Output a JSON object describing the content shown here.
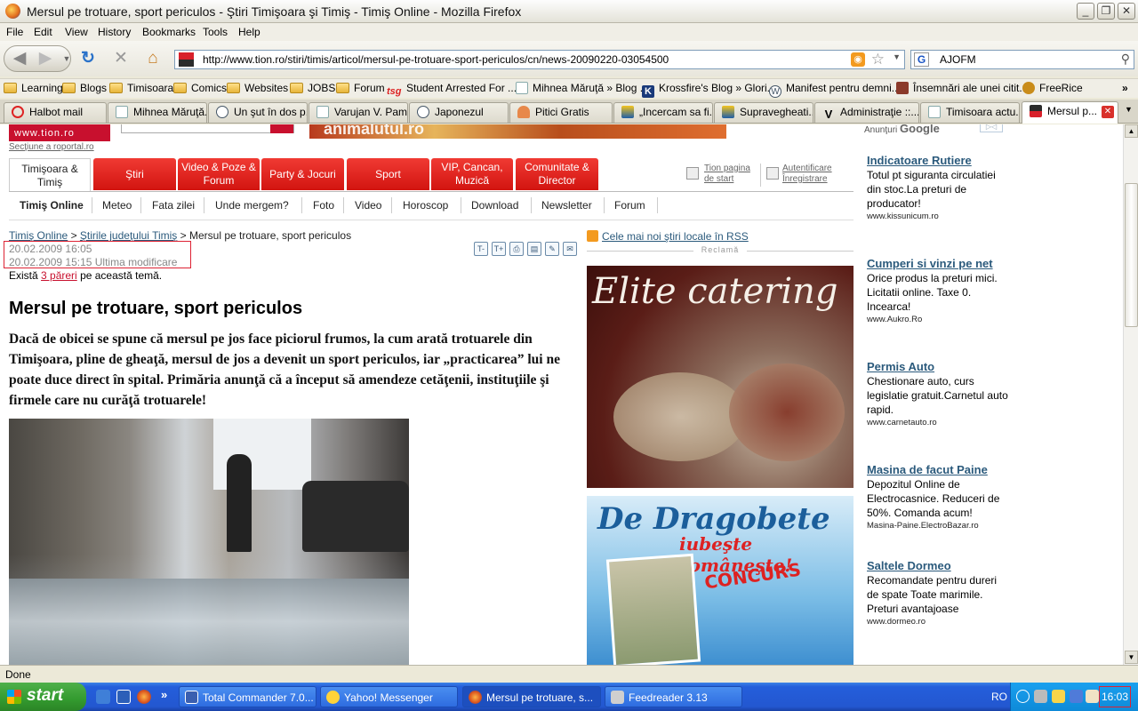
{
  "window": {
    "title": "Mersul pe trotuare, sport periculos - Ştiri Timişoara şi Timiş - Timiş Online - Mozilla Firefox"
  },
  "menu": [
    "File",
    "Edit",
    "View",
    "History",
    "Bookmarks",
    "Tools",
    "Help"
  ],
  "nav": {
    "url": "http://www.tion.ro/stiri/timis/articol/mersul-pe-trotuare-sport-periculos/cn/news-20090220-03054500",
    "search_value": "AJOFM"
  },
  "bookmarks": [
    {
      "label": "Learning",
      "icon": "folder-icon"
    },
    {
      "label": "Blogs",
      "icon": "folder-icon"
    },
    {
      "label": "Timisoara",
      "icon": "folder-icon"
    },
    {
      "label": "Comics",
      "icon": "folder-icon"
    },
    {
      "label": "Websites",
      "icon": "folder-icon"
    },
    {
      "label": "JOBS",
      "icon": "folder-icon"
    },
    {
      "label": "Forum",
      "icon": "folder-icon"
    },
    {
      "label": "Student Arrested For ...",
      "icon": "tsg-icon"
    },
    {
      "label": "Mihnea Măruţă » Blog ...",
      "icon": "page-icon"
    },
    {
      "label": "Krossfire's Blog » Glori...",
      "icon": "k-icon"
    },
    {
      "label": "Manifest pentru demni...",
      "icon": "wordpress-icon"
    },
    {
      "label": "Însemnări ale unei citit...",
      "icon": "avatar-icon"
    },
    {
      "label": "FreeRice",
      "icon": "freerice-icon"
    }
  ],
  "tabs": [
    {
      "label": "Halbot mail",
      "icon": "no-entry-icon"
    },
    {
      "label": "Mihnea Măruţă...",
      "icon": "page-icon"
    },
    {
      "label": "Un şut în dos p...",
      "icon": "wordpress-icon"
    },
    {
      "label": "Varujan V. Pam...",
      "icon": "page-icon"
    },
    {
      "label": "Japonezul",
      "icon": "wordpress-icon"
    },
    {
      "label": "Pitici Gratis",
      "icon": "gnome-icon"
    },
    {
      "label": "„Incercam sa fi...",
      "icon": "news-icon"
    },
    {
      "label": "Supravegheati...",
      "icon": "news-icon"
    },
    {
      "label": "Administraţie ::...",
      "icon": "v-icon"
    },
    {
      "label": "Timisoara actu...",
      "icon": "page-icon"
    },
    {
      "label": "Mersul p...",
      "icon": "tion-icon",
      "active": true
    }
  ],
  "site": {
    "logo": "www.tion.ro",
    "banner": "animalutul.ro",
    "sectiune": "Secţiune a roportal.ro",
    "main_nav_home": "Timişoara & Timiş",
    "main_nav": [
      "Ştiri",
      "Video & Poze & Forum",
      "Party & Jocuri",
      "Sport",
      "VIP, Cancan, Muzică",
      "Comunitate & Director"
    ],
    "tion_home": "Tion pagina de start",
    "auth": "Autentificare Înregistrare",
    "sub_nav": [
      "Timiş Online",
      "Meteo",
      "Fata zilei",
      "Unde mergem?",
      "Foto",
      "Video",
      "Horoscop",
      "Download",
      "Newsletter",
      "Forum"
    ]
  },
  "article": {
    "crumb_1": "Timiş Online",
    "crumb_2": "Ştirile judeţului Timiş",
    "crumb_3": "Mersul pe trotuare, sport periculos",
    "date_published": "20.02.2009 16:05",
    "date_modified": "20.02.2009 15:15 Ultima modificare",
    "opinions_prefix": "Există",
    "opinions_count": "3 păreri",
    "opinions_suffix": "pe această temă.",
    "title": "Mersul pe trotuare, sport periculos",
    "lead": "Dacă de obicei se spune că mersul pe jos face piciorul frumos, la cum arată trotuarele din Timişoara, pline de gheaţă, mersul de jos a devenit un sport periculos, iar „practicarea” lui ne poate duce direct în spital. Primăria anunţă că a început să amendeze cetăţenii, instituţiile şi firmele care nu curăţă trotuarele!",
    "tools": [
      "T-",
      "T+",
      "print-icon",
      "save-icon",
      "comment-icon",
      "email-icon"
    ]
  },
  "sidebar": {
    "rss": "Cele mai noi ştiri locale în RSS",
    "reclama": "Reclamă",
    "ad1_title": "Elite catering",
    "ad2_title": "De Dragobete",
    "ad2_sub": "iubeşte româneşte!",
    "ad2_badge": "CONCURS"
  },
  "google_ads": {
    "label": "Anunţuri",
    "brand": "Google",
    "ab": "AdChoices",
    "items": [
      {
        "title": "Indicatoare Rutiere",
        "body": "Totul pt siguranta circulatiei din stoc.La preturi de producator!",
        "url": "www.kissunicum.ro"
      },
      {
        "title": "Cumperi si vinzi pe net",
        "body": "Orice produs la preturi mici. Licitatii online. Taxe 0. Incearca!",
        "url": "www.Aukro.Ro"
      },
      {
        "title": "Permis Auto",
        "body": "Chestionare auto, curs legislatie gratuit.Carnetul auto rapid.",
        "url": "www.carnetauto.ro"
      },
      {
        "title": "Masina de facut Paine",
        "body": "Depozitul Online de Electrocasnice. Reduceri de 50%. Comanda acum!",
        "url": "Masina-Paine.ElectroBazar.ro"
      },
      {
        "title": "Saltele Dormeo",
        "body": "Recomandate pentru dureri de spate Toate marimile. Preturi avantajoase",
        "url": "www.dormeo.ro"
      }
    ]
  },
  "status": "Done",
  "taskbar": {
    "start": "start",
    "items": [
      {
        "label": "Total Commander 7.0...",
        "icon": "floppy-icon"
      },
      {
        "label": "Yahoo! Messenger",
        "icon": "smiley-icon"
      },
      {
        "label": "Mersul pe trotuare, s...",
        "icon": "firefox-icon",
        "active": true
      },
      {
        "label": "Feedreader 3.13",
        "icon": "cube-icon"
      }
    ],
    "lang": "RO",
    "clock": "16:03"
  },
  "colors": {
    "site_red": "#d21410",
    "link_blue": "#2b5a7c",
    "xp_blue": "#245edb",
    "start_green": "#339a2f"
  }
}
